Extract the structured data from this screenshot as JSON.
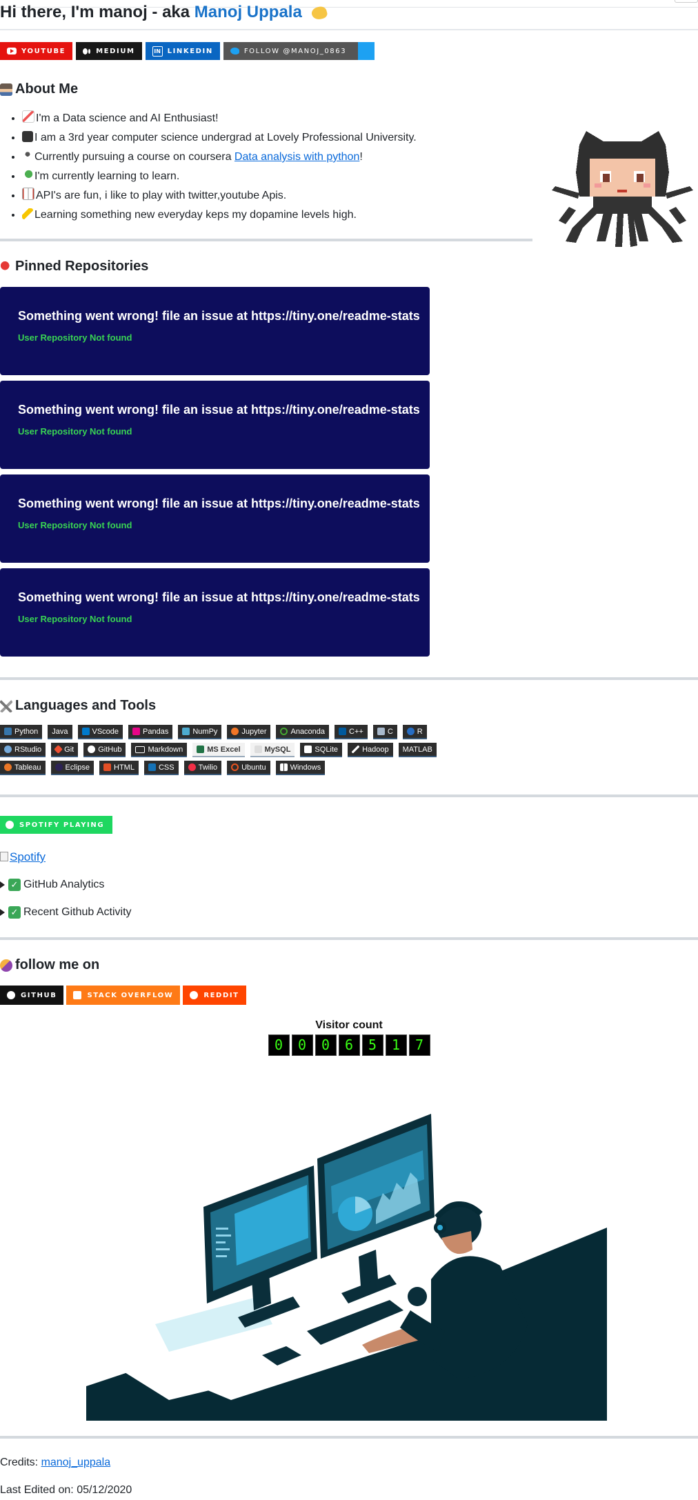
{
  "header": {
    "greeting": "Hi there, I'm manoj - aka",
    "name": "Manoj Uppala"
  },
  "social_badges": [
    {
      "label": "YouTube",
      "icon": "youtube-icon"
    },
    {
      "label": "Medium",
      "icon": "medium-icon"
    },
    {
      "label": "LinkedIn",
      "icon": "linkedin-icon"
    },
    {
      "label": "Follow @manoj_0863",
      "icon": "twitter-icon"
    }
  ],
  "about": {
    "heading": "About Me",
    "items": [
      {
        "text": "I'm a Data science and AI Enthusiast!"
      },
      {
        "text": "I am a 3rd year computer science undergrad at Lovely Professional University."
      },
      {
        "text_before": "Currently pursuing a course on coursera ",
        "link": "Data analysis with python",
        "text_after": "!"
      },
      {
        "text": "I'm currently learning to learn."
      },
      {
        "text": "API's are fun, i like to play with twitter,youtube Apis."
      },
      {
        "text": "Learning something new everyday keps my dopamine levels high."
      }
    ]
  },
  "pinned": {
    "heading": "Pinned Repositories",
    "cards": [
      {
        "message": "Something went wrong! file an issue at https://tiny.one/readme-stats",
        "detail": "User Repository Not found"
      },
      {
        "message": "Something went wrong! file an issue at https://tiny.one/readme-stats",
        "detail": "User Repository Not found"
      },
      {
        "message": "Something went wrong! file an issue at https://tiny.one/readme-stats",
        "detail": "User Repository Not found"
      },
      {
        "message": "Something went wrong! file an issue at https://tiny.one/readme-stats",
        "detail": "User Repository Not found"
      }
    ]
  },
  "tools": {
    "heading": "Languages and Tools",
    "rows": [
      [
        "Python",
        "Java",
        "VScode",
        "Pandas",
        "NumPy",
        "Jupyter",
        "Anaconda",
        "C++",
        "C",
        "R"
      ],
      [
        "RStudio",
        "Git",
        "GitHub",
        "Markdown",
        "MS Excel",
        "MySQL",
        "SQLite",
        "Hadoop",
        "MATLAB"
      ],
      [
        "Tableau",
        "Eclipse",
        "HTML",
        "CSS",
        "Twilio",
        "Ubuntu",
        "Windows"
      ]
    ]
  },
  "spotify": {
    "badge": "SPOTIFY PLAYING",
    "image_alt": "Spotify"
  },
  "details": [
    {
      "label": "GitHub Analytics"
    },
    {
      "label": "Recent Github Activity"
    }
  ],
  "follow": {
    "heading": "follow me on",
    "badges": [
      {
        "label": "GITHUB"
      },
      {
        "label": "STACK OVERFLOW"
      },
      {
        "label": "REDDIT"
      }
    ]
  },
  "visitor": {
    "label": "Visitor count",
    "digits": [
      "0",
      "0",
      "0",
      "6",
      "5",
      "1",
      "7"
    ]
  },
  "footer": {
    "credits_label": "Credits:",
    "credits_link": "manoj_uppala",
    "last_edited": "Last Edited on: 05/12/2020"
  },
  "colors": {
    "accent_link": "#0969da",
    "name_blue": "#1a73c9",
    "card_bg": "#0d0d5c",
    "card_detail": "#39d353",
    "spotify_green": "#1ed760",
    "counter_digit": "#39ff14"
  }
}
